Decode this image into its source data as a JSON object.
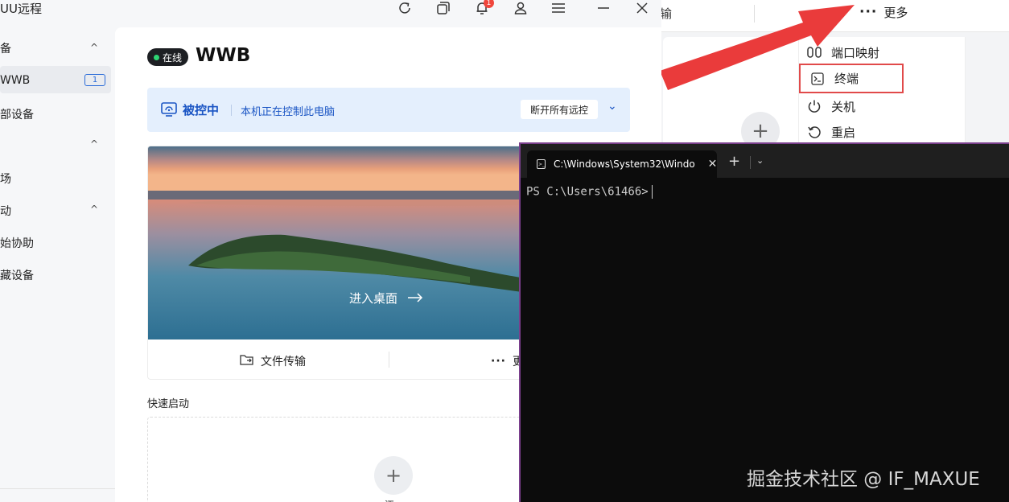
{
  "main_window": {
    "app_name": "UU远程",
    "notification_count": "1",
    "titlebar_icons": [
      "refresh-icon",
      "multi-window-icon",
      "bell-icon",
      "user-icon",
      "menu-icon",
      "minimize-icon",
      "close-icon"
    ]
  },
  "sidebar": {
    "items": [
      {
        "label": "备",
        "chevron": "^"
      },
      {
        "label": "WWB",
        "count": "1"
      },
      {
        "label": "部设备"
      },
      {
        "label": "",
        "chevron": "^"
      },
      {
        "label": "场"
      },
      {
        "label": "动",
        "chevron": "^"
      },
      {
        "label": "始协助"
      },
      {
        "label": "藏设备"
      }
    ]
  },
  "device": {
    "status": "在线",
    "name": "WWB",
    "status_color": "#2ed573"
  },
  "control_banner": {
    "title": "被控中",
    "description": "本机正在控制此电脑",
    "disconnect_label": "断开所有远控"
  },
  "preview": {
    "enter_label": "进入桌面",
    "actions": [
      {
        "label": "文件传输",
        "icon": "folder-transfer-icon"
      },
      {
        "label": "更",
        "icon": "more-dots-icon"
      }
    ]
  },
  "quick_launch": {
    "label": "快速启动",
    "add_label": "添"
  },
  "background_app": {
    "partial_label": "输",
    "more_label": "更多",
    "menu": [
      {
        "label": "端口映射",
        "icon": "port-mapping-icon"
      },
      {
        "label": "终端",
        "icon": "terminal-icon",
        "highlighted": true
      },
      {
        "label": "关机",
        "icon": "power-icon"
      },
      {
        "label": "重启",
        "icon": "restart-icon"
      }
    ]
  },
  "terminal": {
    "tab_title": "C:\\Windows\\System32\\Windo",
    "prompt": "PS C:\\Users\\61466>"
  },
  "watermark": "掘金技术社区 @ IF_MAXUE",
  "colors": {
    "accent_blue": "#1a55c4",
    "annotation_red": "#e14a4a",
    "terminal_border": "#7a3f8c"
  }
}
